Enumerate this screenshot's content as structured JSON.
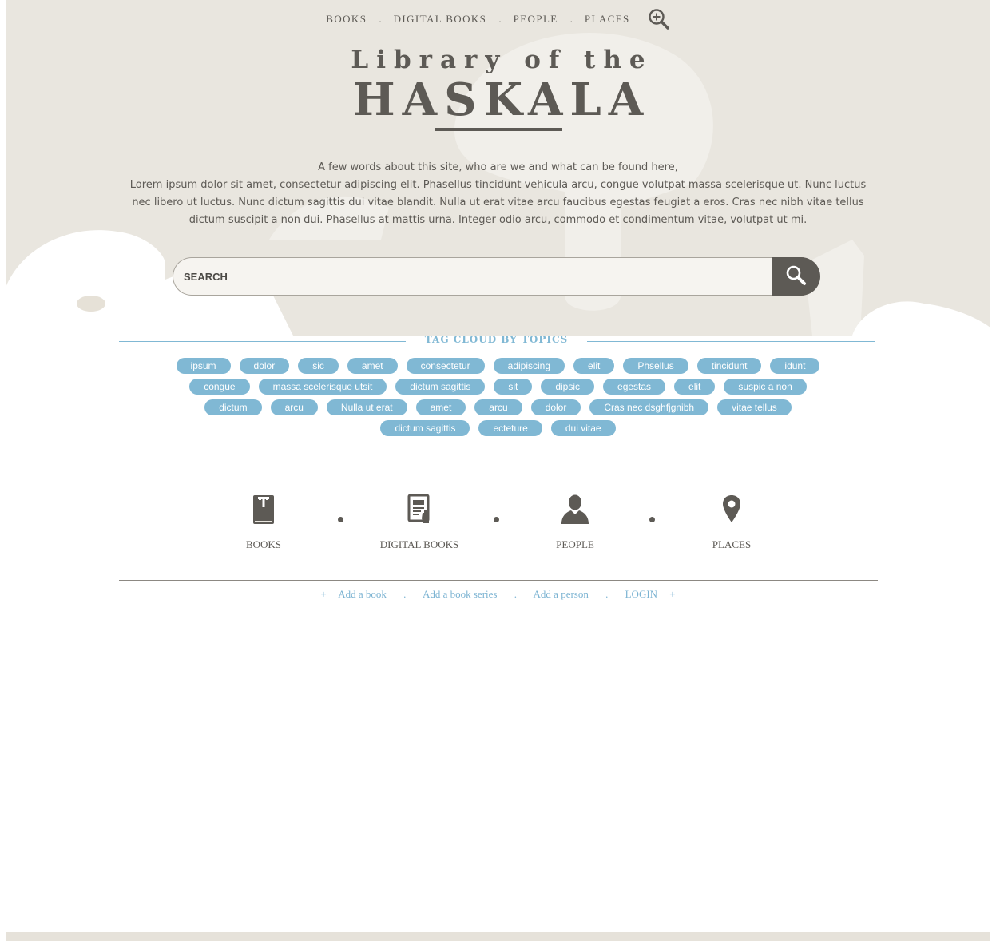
{
  "nav": {
    "items": [
      {
        "label": "BOOKS"
      },
      {
        "label": "DIGITAL BOOKS"
      },
      {
        "label": "PEOPLE"
      },
      {
        "label": "PLACES"
      }
    ],
    "separator": ".",
    "search_icon": "zoom-in-search-icon"
  },
  "title": {
    "line1": "Library of the",
    "line2": "HASKALA"
  },
  "intro": {
    "line1": "A few words about this site, who are we and what can be found here,",
    "body": "Lorem ipsum dolor sit amet, consectetur adipiscing elit. Phasellus tincidunt vehicula arcu, congue volutpat massa scelerisque ut. Nunc luctus nec libero ut luctus. Nunc dictum sagittis dui vitae blandit. Nulla ut erat vitae arcu faucibus egestas feugiat a eros. Cras nec nibh vitae tellus dictum suscipit a non dui. Phasellus at mattis urna. Integer odio arcu, commodo et condimentum vitae, volutpat ut mi."
  },
  "search": {
    "placeholder": "SEARCH",
    "value": "",
    "button_icon": "search-icon"
  },
  "tags": {
    "heading": "TAG CLOUD BY TOPICS",
    "rows": [
      [
        "ipsum",
        "dolor",
        "sic",
        "amet",
        "consectetur",
        "adipiscing",
        "elit",
        "Phsellus",
        "tincidunt",
        "idunt"
      ],
      [
        "congue",
        "massa scelerisque utsit",
        "dictum sagittis",
        "sit",
        "dipsic",
        "egestas",
        "elit",
        "suspic a non"
      ],
      [
        "dictum",
        "arcu",
        "Nulla ut erat",
        "amet",
        "arcu",
        "dolor",
        "Cras nec dsghfjgnibh",
        "vitae tellus"
      ],
      [
        "dictum sagittis",
        "ecteture",
        "dui vitae"
      ]
    ]
  },
  "categories": [
    {
      "label": "BOOKS",
      "icon": "book-icon"
    },
    {
      "label": "DIGITAL BOOKS",
      "icon": "digital-book-icon"
    },
    {
      "label": "PEOPLE",
      "icon": "person-icon"
    },
    {
      "label": "PLACES",
      "icon": "map-pin-icon"
    }
  ],
  "footer": {
    "plus": "+",
    "separator": ".",
    "links": [
      {
        "label": "Add a book"
      },
      {
        "label": "Add a book series"
      },
      {
        "label": "Add a person"
      },
      {
        "label": "LOGIN"
      }
    ]
  },
  "colors": {
    "text": "#5d5a55",
    "accent": "#80b8d4",
    "hero_bg": "#e9e6df"
  }
}
